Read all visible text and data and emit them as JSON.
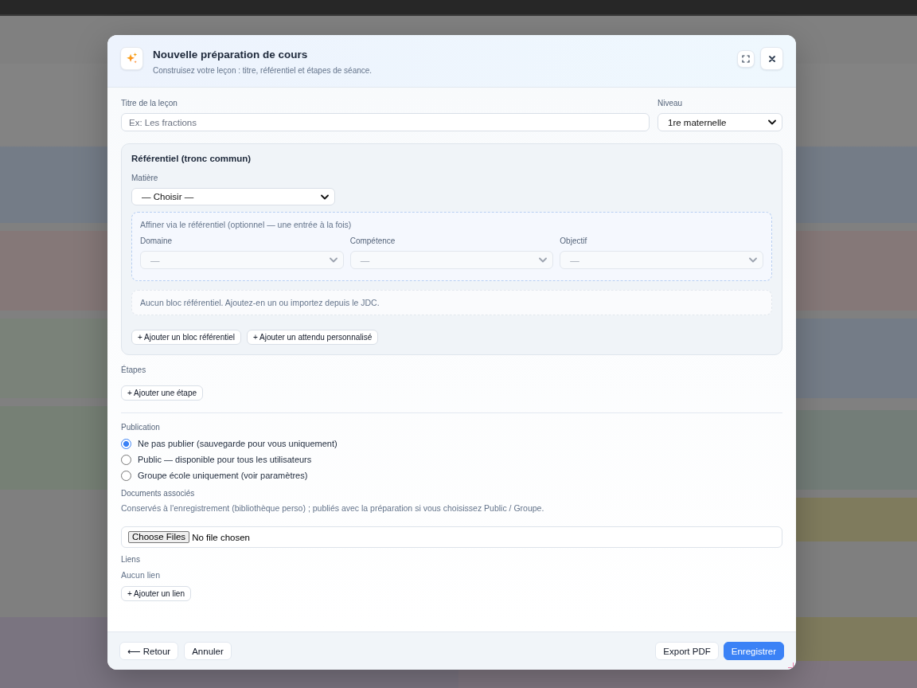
{
  "dialog": {
    "title": "Nouvelle préparation de cours",
    "subtitle": "Construisez votre leçon : titre, référentiel et étapes de séance."
  },
  "lesson": {
    "title_field": {
      "label": "Titre de la leçon",
      "placeholder": "Ex: Les fractions"
    },
    "level_field": {
      "label": "Niveau",
      "value": "1re maternelle"
    }
  },
  "referentiel": {
    "title": "Référentiel (tronc commun)",
    "subject_field": {
      "label": "Matière",
      "value": "— Choisir —"
    },
    "refine": {
      "hint": "Affiner via le référentiel (optionnel — une entrée à la fois)",
      "fields": [
        {
          "label": "Domaine",
          "placeholder": "—",
          "disabled": true
        },
        {
          "label": "Compétence",
          "placeholder": "—",
          "disabled": true
        },
        {
          "label": "Objectif",
          "placeholder": "—",
          "disabled": true
        }
      ]
    },
    "empty_message": "Aucun bloc référentiel. Ajoutez-en un ou importez depuis le JDC.",
    "buttons": [
      "+ Ajouter un bloc référentiel",
      "+ Ajouter un attendu personnalisé"
    ]
  },
  "steps": {
    "label": "Étapes",
    "button": "+ Ajouter une étape"
  },
  "publication": {
    "label": "Publication",
    "options": [
      {
        "label": "Ne pas publier (sauvegarde pour vous uniquement)",
        "selected": true
      },
      {
        "label": "Public — disponible pour tous les utilisateurs",
        "selected": false
      },
      {
        "label": "Groupe école uniquement (voir paramètres)",
        "selected": false
      }
    ]
  },
  "documents": {
    "label": "Documents associés",
    "description": "Conservés à l'enregistrement (bibliothèque perso) ; publiés avec la préparation si vous choisissez Public / Groupe.",
    "file_input": {
      "button": "Choose Files",
      "status": "No file chosen"
    }
  },
  "links": {
    "label": "Liens",
    "empty_message": "Aucun lien",
    "button": "+ Ajouter un lien"
  },
  "footer": {
    "left_buttons": [
      {
        "label": "⟵ Retour",
        "kind": "secondary"
      },
      {
        "label": "Annuler",
        "kind": "secondary"
      }
    ],
    "right_buttons": [
      {
        "label": "Export PDF",
        "kind": "secondary"
      },
      {
        "label": "Enregistrer",
        "kind": "primary"
      }
    ]
  }
}
